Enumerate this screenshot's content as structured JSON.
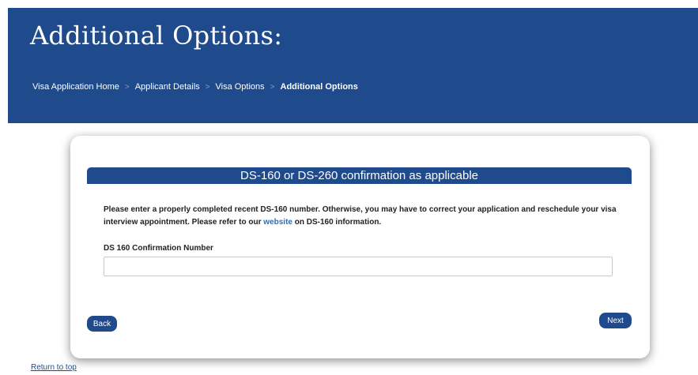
{
  "header": {
    "title": "Additional Options:",
    "breadcrumb": [
      {
        "label": "Visa Application Home"
      },
      {
        "label": "Applicant Details"
      },
      {
        "label": "Visa Options"
      },
      {
        "label": "Additional Options",
        "current": true
      }
    ],
    "separator": ">"
  },
  "section": {
    "title": "DS-160 or DS-260 confirmation as applicable",
    "instructions_before_link": "Please enter a properly completed recent DS-160 number. Otherwise, you may have to correct your application and reschedule your visa interview appointment. Please refer to our ",
    "instructions_link": "website",
    "instructions_after_link": " on DS-160 information.",
    "field_label": "DS 160 Confirmation Number",
    "field_value": "",
    "field_placeholder": ""
  },
  "buttons": {
    "back": "Back",
    "next": "Next"
  },
  "footer": {
    "return_to_top": "Return to top"
  },
  "colors": {
    "brand_blue": "#1f4a8c",
    "link_blue": "#2a6ebf"
  }
}
